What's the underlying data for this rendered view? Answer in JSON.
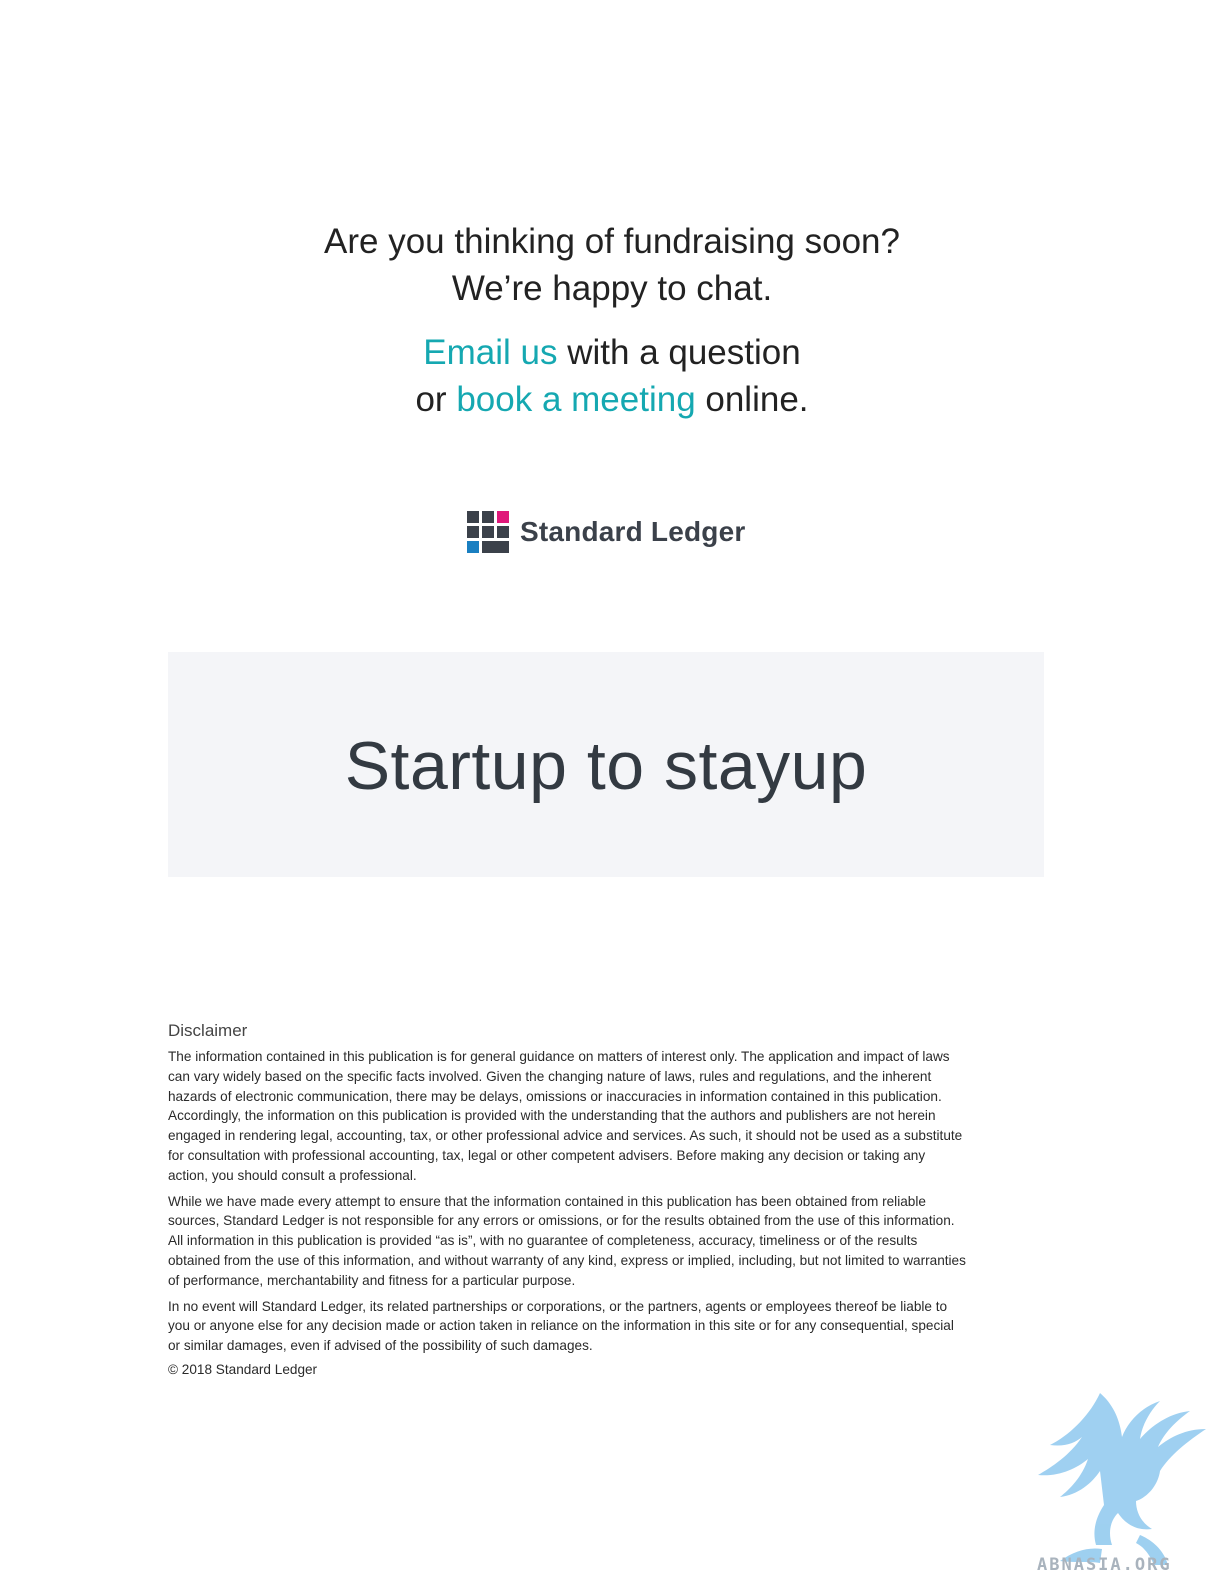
{
  "cta": {
    "line1": "Are you thinking of fundraising soon?",
    "line2": "We’re happy to chat.",
    "email_link": "Email us",
    "email_rest": " with a question",
    "or": "or ",
    "meeting_link": "book a meeting",
    "online": " online.",
    "link_color": "#15a8b1"
  },
  "logo": {
    "name": "Standard Ledger",
    "icon": "grid-logo-icon",
    "colors": {
      "dark": "#3b414a",
      "pink": "#e0187a",
      "blue": "#1a7fc1"
    }
  },
  "banner": {
    "title": "Startup to stayup"
  },
  "disclaimer": {
    "heading": "Disclaimer",
    "paragraphs": [
      "The information contained in this publication is for general guidance on matters of interest only. The application and impact of laws can vary widely based on the specific facts involved. Given the changing nature of laws, rules and regulations, and the inherent hazards of electronic communication, there may be delays, omissions or inaccuracies in information contained in this publication. Accordingly, the information on this publication is provided with the understanding that the authors and publishers are not herein engaged in rendering legal, accounting, tax, or other professional advice and services. As such, it should not be used as a substitute for consultation with professional accounting, tax, legal or other competent advisers. Before making any decision or taking any action, you should consult a professional.",
      "While we have made every attempt to ensure that the information contained in this publication has been obtained from reliable sources, Standard Ledger is not responsible for any errors or omissions, or for the results obtained from the use of this information. All information in this publication is provided “as is”, with no guarantee of completeness, accuracy, timeliness or of the results obtained from the use of this information, and without warranty of any kind, express or implied, including, but not limited to warranties of performance, merchantability and fitness for a particular purpose.",
      "In no event will Standard Ledger, its related partnerships or corporations, or the partners, agents or employees thereof be liable to you or anyone else for any decision made or action taken in reliance on the information in this site or for any consequential, special or similar damages, even if advised of the possibility of such damages."
    ],
    "copyright": "© 2018 Standard Ledger"
  },
  "watermark": {
    "text": "ABNASIA.ORG",
    "icon": "griffin-icon",
    "color": "#8ec8ee"
  }
}
